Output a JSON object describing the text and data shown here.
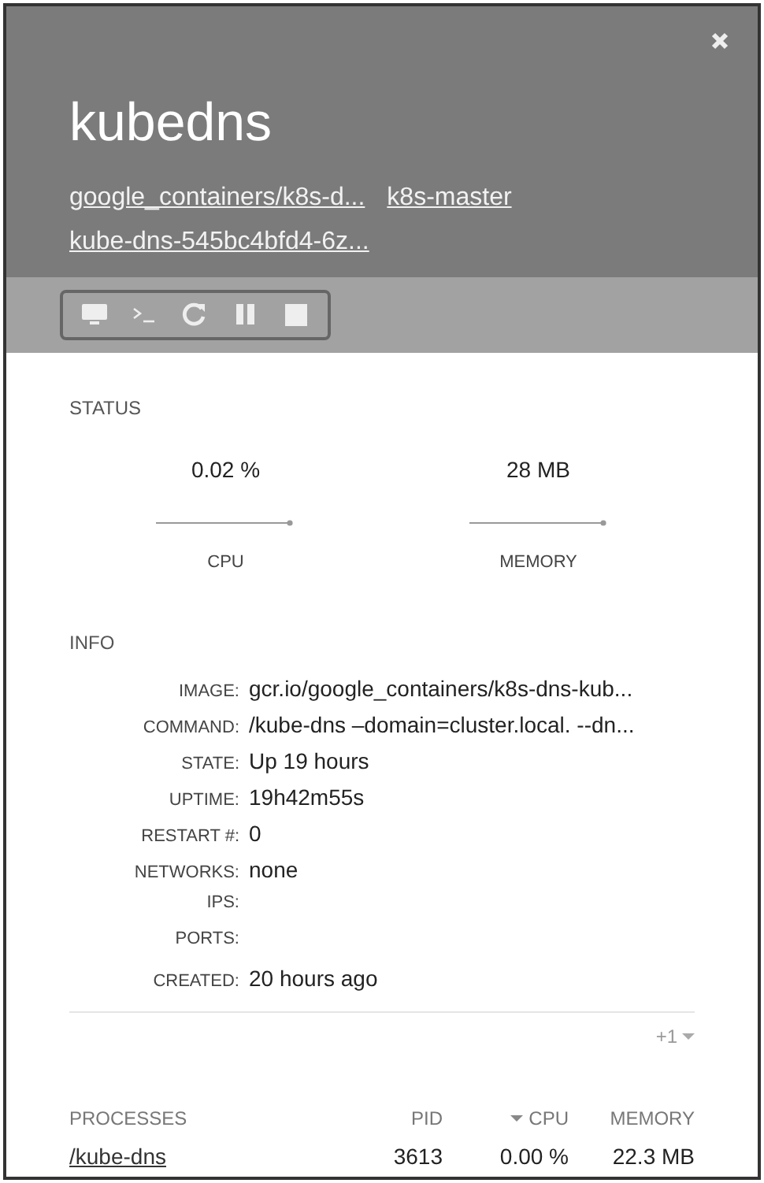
{
  "header": {
    "title": "kubedns",
    "links": [
      "google_containers/k8s-d...",
      "k8s-master",
      "kube-dns-545bc4bfd4-6z..."
    ]
  },
  "toolbar": {
    "buttons": [
      {
        "kind": "monitor"
      },
      {
        "kind": "terminal"
      },
      {
        "kind": "restart"
      },
      {
        "kind": "pause"
      },
      {
        "kind": "stop"
      }
    ]
  },
  "status": {
    "heading": "STATUS",
    "meters": [
      {
        "value": "0.02 %",
        "label": "CPU"
      },
      {
        "value": "28 MB",
        "label": "MEMORY"
      }
    ]
  },
  "info": {
    "heading": "INFO",
    "rows": [
      {
        "label": "IMAGE:",
        "value": "gcr.io/google_containers/k8s-dns-kub..."
      },
      {
        "label": "COMMAND:",
        "value": "/kube-dns –domain=cluster.local. --dn..."
      },
      {
        "label": "STATE:",
        "value": "Up 19 hours"
      },
      {
        "label": "UPTIME:",
        "value": "19h42m55s"
      },
      {
        "label": "RESTART #:",
        "value": "0"
      },
      {
        "label": "NETWORKS:",
        "value": "none"
      },
      {
        "label": "IPS:"
      },
      {
        "label": "PORTS:"
      },
      {
        "label": "CREATED:",
        "value": "20 hours ago"
      }
    ],
    "more": "+1"
  },
  "processes": {
    "columns": [
      {
        "label": "PROCESSES",
        "sorted": false
      },
      {
        "label": "PID",
        "sorted": false
      },
      {
        "label": "CPU",
        "sorted": true
      },
      {
        "label": "MEMORY",
        "sorted": false
      }
    ],
    "rows": [
      [
        "/kube-dns",
        "3613",
        "0.00 %",
        "22.3 MB"
      ]
    ]
  }
}
